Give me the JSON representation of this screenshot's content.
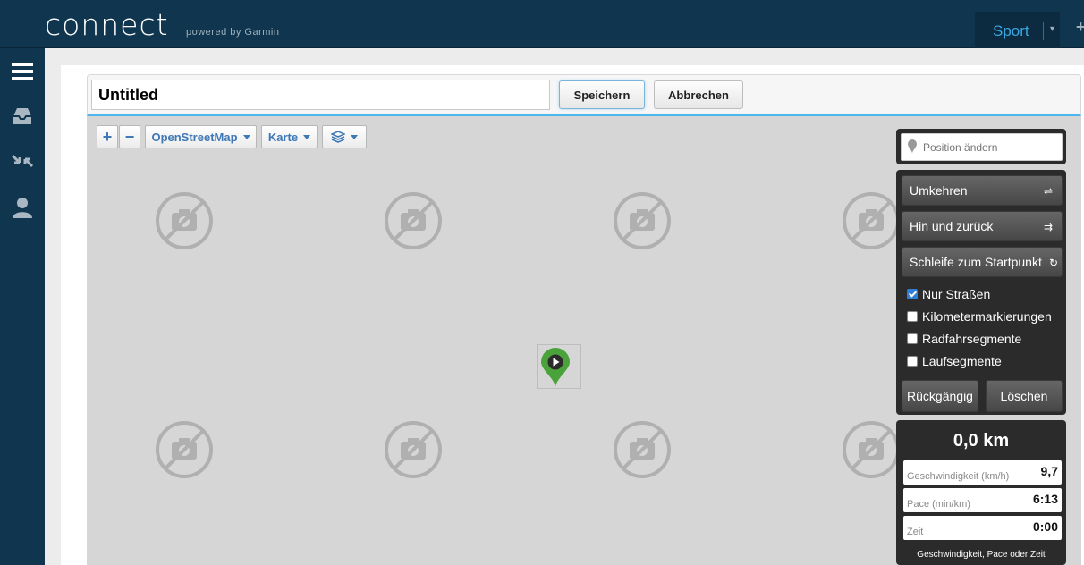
{
  "app": {
    "logo": "connect",
    "logo_sub": "powered by Garmin"
  },
  "topbar": {
    "sport_label": "Sport"
  },
  "route": {
    "title_value": "Untitled",
    "save_label": "Speichern",
    "cancel_label": "Abbrechen"
  },
  "map_toolbar": {
    "zoom_in": "+",
    "zoom_out": "−",
    "provider": "OpenStreetMap",
    "map_type": "Karte",
    "layers_icon": "layers-icon"
  },
  "panel": {
    "position_placeholder": "Position ändern",
    "reverse_label": "Umkehren",
    "out_back_label": "Hin und zurück",
    "loop_label": "Schleife zum Startpunkt",
    "options": [
      {
        "label": "Nur Straßen",
        "checked": true
      },
      {
        "label": "Kilometermarkierungen",
        "checked": false
      },
      {
        "label": "Radfahrsegmente",
        "checked": false
      },
      {
        "label": "Laufsegmente",
        "checked": false
      }
    ],
    "undo_label": "Rückgängig",
    "delete_label": "Löschen"
  },
  "stats": {
    "distance": "0,0 km",
    "speed_label": "Geschwindigkeit (km/h)",
    "speed_value": "9,7",
    "pace_label": "Pace (min/km)",
    "pace_value": "6:13",
    "time_label": "Zeit",
    "time_value": "0:00",
    "note": "Geschwindigkeit, Pace oder Zeit"
  },
  "colors": {
    "topbar": "#10354e",
    "accent": "#3aa7e3",
    "marker": "#4aa23a",
    "panel_dark": "#2b2b2b"
  }
}
